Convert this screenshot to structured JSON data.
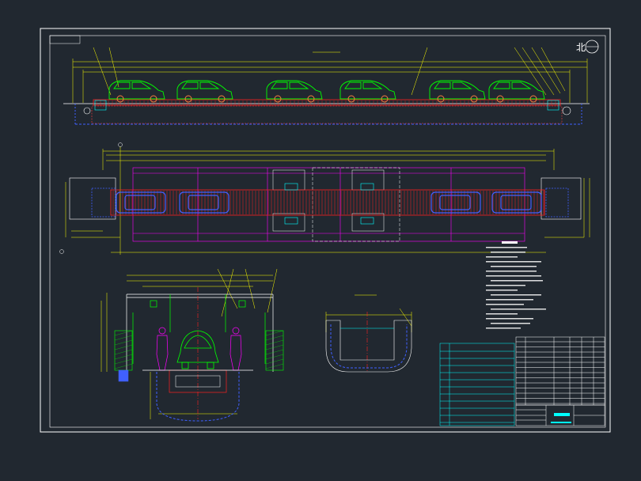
{
  "drawing": {
    "north_symbol": "北",
    "scale_label": "1:1",
    "cars_side": [
      138,
      224,
      337,
      430,
      543,
      618
    ],
    "cars_top": [
      150,
      230,
      548,
      625
    ]
  },
  "colors": {
    "background": "#212830",
    "frame": "#ffffff",
    "dimension": "#ffff00",
    "car": "#00ff00",
    "conveyor": "#ff2020",
    "pit": "#4060ff",
    "grid": "#ff00ff",
    "section": "#00ffff",
    "worker": "#ff00ff"
  }
}
